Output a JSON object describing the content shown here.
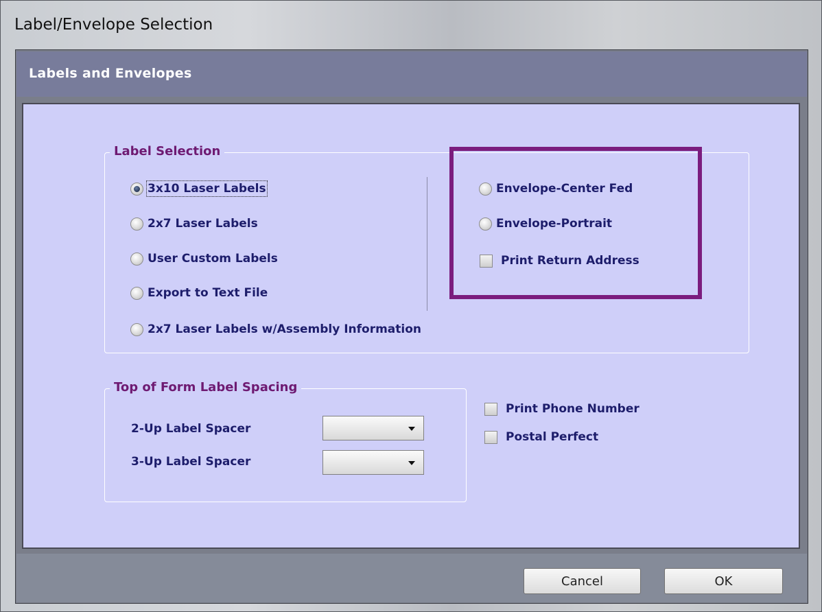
{
  "window": {
    "title": "Label/Envelope Selection"
  },
  "header": {
    "title": "Labels and Envelopes"
  },
  "label_selection": {
    "legend": "Label Selection",
    "options": [
      {
        "label": "3x10 Laser Labels",
        "checked": true
      },
      {
        "label": "2x7 Laser Labels",
        "checked": false
      },
      {
        "label": "User Custom Labels",
        "checked": false
      },
      {
        "label": "Export to Text File",
        "checked": false
      },
      {
        "label": "2x7 Laser Labels w/Assembly Information",
        "checked": false
      }
    ],
    "envelope_options": [
      {
        "label": "Envelope-Center Fed",
        "checked": false
      },
      {
        "label": "Envelope-Portrait",
        "checked": false
      }
    ],
    "print_return_address": {
      "label": "Print Return Address",
      "checked": false
    }
  },
  "spacing": {
    "legend": "Top of Form Label Spacing",
    "two_up_label": "2-Up Label Spacer",
    "two_up_value": "",
    "three_up_label": "3-Up Label Spacer",
    "three_up_value": ""
  },
  "extras": {
    "print_phone_number": {
      "label": "Print Phone Number",
      "checked": false
    },
    "postal_perfect": {
      "label": "Postal Perfect",
      "checked": false
    }
  },
  "buttons": {
    "cancel": "Cancel",
    "ok": "OK"
  },
  "colors": {
    "content_bg": "#cfcff9",
    "legend_text": "#6e1a72",
    "option_text": "#1d1d6b",
    "highlight_box": "#7b1d7e",
    "header_band": "#787c9b"
  }
}
